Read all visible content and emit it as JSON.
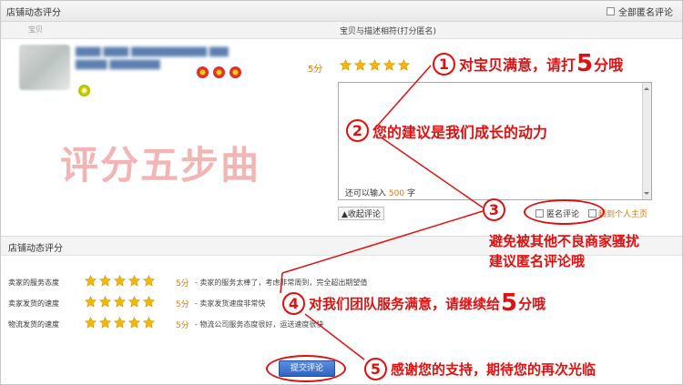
{
  "header": {
    "title": "店铺动态评分",
    "anonymous_all_label": "全部匿名评论"
  },
  "columns": {
    "product": "宝贝",
    "rating": "宝贝与描述相符(打分匿名)"
  },
  "overlay_title": "评分五步曲",
  "product_rating": {
    "score_label": "5分",
    "stars": 5
  },
  "comment_box": {
    "remaining_prefix": "还可以输入",
    "remaining_count": "500",
    "remaining_suffix": "字"
  },
  "collapse_label": "▲收起评论",
  "anonymous_label": "匿名评论",
  "homepage_label": "晒到个人主页",
  "shop": {
    "title": "店铺动态评分",
    "rows": [
      {
        "label": "卖家的服务态度",
        "score": "5分",
        "desc": "- 卖家的服务太棒了，考虑非常周到，完全超出期望值",
        "stars": 5
      },
      {
        "label": "卖家发货的速度",
        "score": "5分",
        "desc": "- 卖家发货速度非常快",
        "stars": 5
      },
      {
        "label": "物流发货的速度",
        "score": "5分",
        "desc": "- 物流公司服务态度很好，运送速度很快",
        "stars": 5
      }
    ]
  },
  "submit_label": "提交评论",
  "annotations": [
    {
      "num": "1",
      "pre": "对宝贝满意，请打",
      "big": "5",
      "post": "分哦"
    },
    {
      "num": "2",
      "text": "您的建议是我们成长的动力"
    },
    {
      "num": "3",
      "line1": "避免被其他不良商家骚扰",
      "line2": "建议匿名评论哦"
    },
    {
      "num": "4",
      "pre": "对我们团队服务满意，请继续给",
      "big": "5",
      "post": "分哦"
    },
    {
      "num": "5",
      "text": "感谢您的支持，期待您的再次光临"
    }
  ],
  "colors": {
    "annotation_red": "#e01010",
    "score_orange": "#e07a00",
    "star_yellow": "#f5b800",
    "submit_blue": "#2f63c1"
  }
}
